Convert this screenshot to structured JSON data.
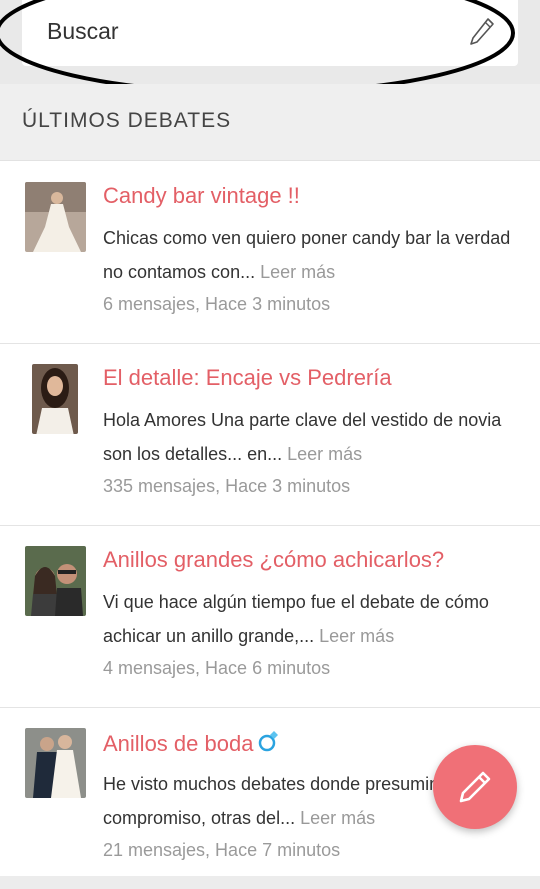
{
  "search": {
    "placeholder": "Buscar"
  },
  "section": {
    "title": "ÚLTIMOS DEBATES"
  },
  "debates": [
    {
      "title": "Candy bar vintage !!",
      "excerpt": "Chicas como ven quiero poner candy bar la verdad no contamos con...",
      "read_more": "Leer más",
      "meta": "6 mensajes, Hace 3 minutos"
    },
    {
      "title": "El detalle: Encaje vs Pedrería",
      "excerpt": "Hola Amores Una parte clave del vestido de novia son los detalles... en...",
      "read_more": "Leer más",
      "meta": "335 mensajes, Hace 3 minutos"
    },
    {
      "title": "Anillos grandes ¿cómo achicarlos?",
      "excerpt": "Vi que hace algún tiempo fue el debate de cómo achicar un anillo grande,...",
      "read_more": "Leer más",
      "meta": "4 mensajes, Hace 6 minutos"
    },
    {
      "title": "Anillos de boda",
      "excerpt": "He visto muchos debates donde presumim de compromiso, otras del...",
      "read_more": "Leer más",
      "meta": "21 mensajes, Hace 7 minutos"
    }
  ],
  "icons": {
    "search": "pencil-icon",
    "ring": "ring-icon",
    "fab": "pencil-icon"
  },
  "colors": {
    "accent": "#e35f66",
    "fab": "#f07077",
    "ring": "#2aa3e0"
  }
}
